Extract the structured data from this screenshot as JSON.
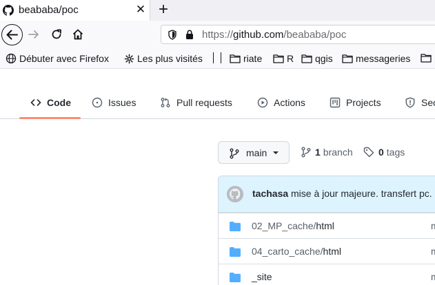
{
  "browser": {
    "tab_title": "beababa/poc",
    "tab_close": "✕",
    "new_tab": "+",
    "url_prefix": "https://",
    "url_domain": "github.com",
    "url_path": "/beababa/poc"
  },
  "bookmarks": [
    {
      "label": "Débuter avec Firefox",
      "icon": "globe-icon"
    },
    {
      "label": "Les plus visités",
      "icon": "gear-icon"
    },
    {
      "label": "riate",
      "icon": "folder-icon"
    },
    {
      "label": "R",
      "icon": "folder-icon"
    },
    {
      "label": "qgis",
      "icon": "folder-icon"
    },
    {
      "label": "messageries",
      "icon": "folder-icon"
    }
  ],
  "repo_tabs": [
    {
      "label": "Code",
      "icon": "code-icon",
      "active": true
    },
    {
      "label": "Issues",
      "icon": "issue-icon"
    },
    {
      "label": "Pull requests",
      "icon": "pull-request-icon"
    },
    {
      "label": "Actions",
      "icon": "play-icon"
    },
    {
      "label": "Projects",
      "icon": "project-icon"
    },
    {
      "label": "Sec",
      "icon": "shield-icon"
    }
  ],
  "branch": {
    "current": "main",
    "branch_count": "1",
    "branch_label": "branch",
    "tag_count": "0",
    "tag_label": "tags"
  },
  "commit": {
    "author": "tachasa",
    "message": "mise à jour majeure. transfert pc."
  },
  "files": [
    {
      "dir": "02_MP_cache/",
      "leaf": "html",
      "trailing": "m"
    },
    {
      "dir": "04_carto_cache/",
      "leaf": "html",
      "trailing": "m"
    },
    {
      "dir": "",
      "leaf": "_site",
      "trailing": "m"
    }
  ],
  "colors": {
    "active_tab_underline": "#fd8c73",
    "commit_bg": "#ddf4ff",
    "folder": "#54aeff"
  }
}
